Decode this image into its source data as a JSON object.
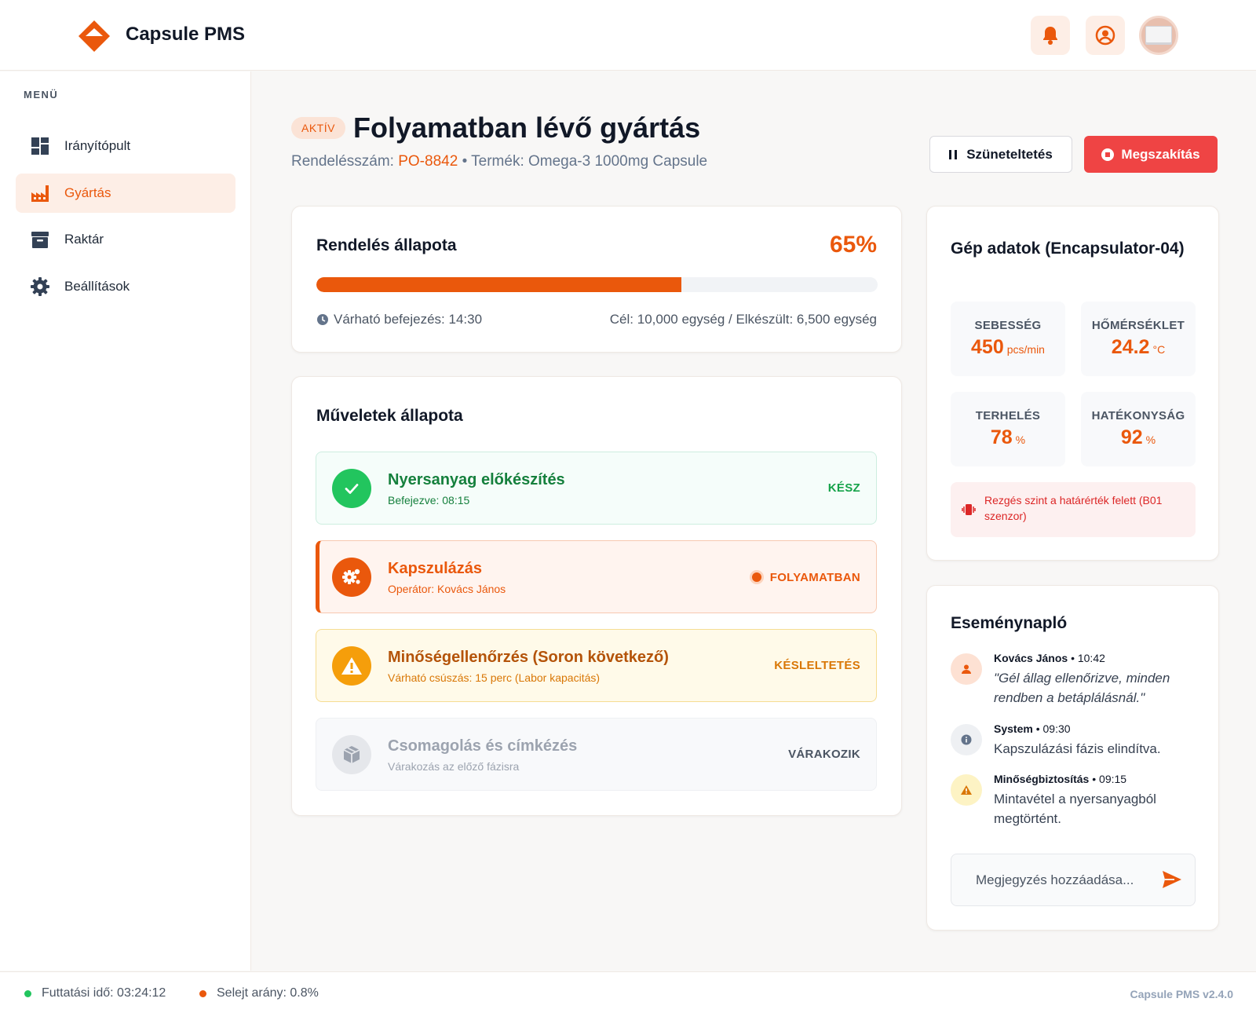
{
  "app": {
    "name": "Capsule PMS",
    "version": "Capsule PMS v2.4.0"
  },
  "header": {
    "icons": [
      "bell-icon",
      "user-circle-icon"
    ]
  },
  "sidebar": {
    "menu_label": "MENÜ",
    "items": [
      {
        "label": "Irányítópult",
        "icon": "dashboard-icon",
        "active": false
      },
      {
        "label": "Gyártás",
        "icon": "factory-icon",
        "active": true
      },
      {
        "label": "Raktár",
        "icon": "archive-box-icon",
        "active": false
      },
      {
        "label": "Beállítások",
        "icon": "gear-icon",
        "active": false
      }
    ]
  },
  "page": {
    "badge": "AKTÍV",
    "title": "Folyamatban lévő gyártás",
    "order_label": "Rendelésszám:",
    "order_number": "PO-8842",
    "product_label": "• Termék: Omega-3 1000mg Capsule",
    "pause_label": "Szüneteltetés",
    "stop_label": "Megszakítás"
  },
  "order_status": {
    "title": "Rendelés állapota",
    "percent_text": "65%",
    "progress": 0.65,
    "eta": "Várható befejezés: 14:30",
    "goal": "Cél: 10,000 egység / Elkészült: 6,500 egység"
  },
  "operations": {
    "title": "Műveletek állapota",
    "items": [
      {
        "title": "Nyersanyag előkészítés",
        "sub": "Befejezve: 08:15",
        "status": "KÉSZ",
        "state": "done",
        "icon": "check-icon"
      },
      {
        "title": "Kapszulázás",
        "sub": "Operátor: Kovács János",
        "status": "FOLYAMATBAN",
        "state": "in-progress",
        "icon": "gears-icon"
      },
      {
        "title": "Minőségellenőrzés (Soron következő)",
        "sub": "Várható csúszás: 15 perc (Labor kapacitás)",
        "status": "KÉSLELTETÉS",
        "state": "delayed",
        "icon": "warning-icon"
      },
      {
        "title": "Csomagolás és címkézés",
        "sub": "Várakozás az előző fázisra",
        "status": "VÁRAKOZIK",
        "state": "waiting",
        "icon": "box-icon"
      }
    ]
  },
  "machine": {
    "title": "Gép adatok (Encapsulator-04)",
    "metrics": [
      {
        "label": "SEBESSÉG",
        "value": "450",
        "unit": "pcs/min"
      },
      {
        "label": "HŐMÉRSÉKLET",
        "value": "24.2",
        "unit": "°C"
      },
      {
        "label": "TERHELÉS",
        "value": "78",
        "unit": "%"
      },
      {
        "label": "HATÉKONYSÁG",
        "value": "92",
        "unit": "%"
      }
    ],
    "alert": "Rezgés szint a határérték felett (B01 szenzor)"
  },
  "log": {
    "title": "Eseménynapló",
    "entries": [
      {
        "author": "Kovács János",
        "time": "• 10:42",
        "text": "\"Gél állag ellenőrizve, minden rendben a betáplálásnál.\"",
        "icon": "user-icon"
      },
      {
        "author": "System",
        "time": "• 09:30",
        "text": "Kapszulázási fázis elindítva.",
        "icon": "info-icon"
      },
      {
        "author": "Minőségbiztosítás",
        "time": "• 09:15",
        "text": "Mintavétel a nyersanyagból megtörtént.",
        "icon": "warning-icon"
      }
    ],
    "note_placeholder": "Megjegyzés hozzáadása..."
  },
  "footer": {
    "runtime": "Futtatási idő: 03:24:12",
    "scrap": "Selejt arány: 0.8%"
  },
  "colors": {
    "accent": "#ea580c",
    "danger": "#ef4444",
    "success": "#22c55e",
    "warning": "#f59e0b"
  }
}
